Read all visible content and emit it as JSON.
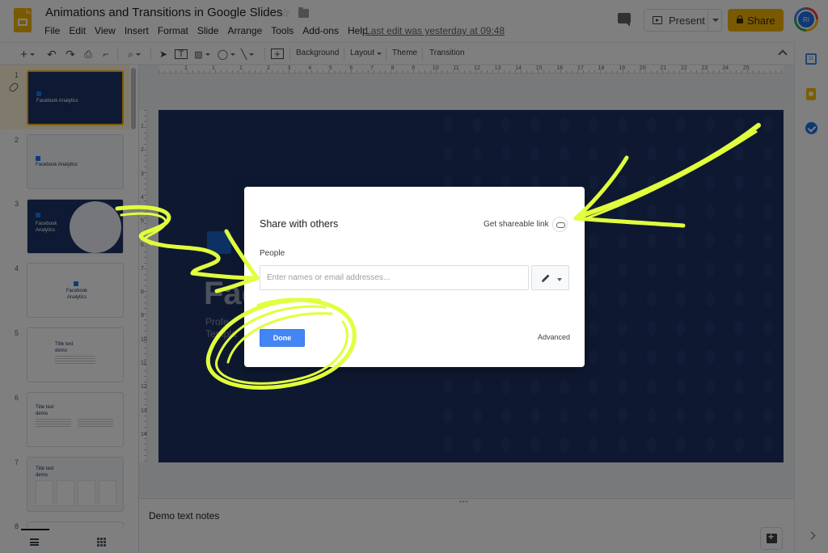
{
  "app": {
    "doc_title": "Animations and Transitions in Google Slides",
    "menu": [
      "File",
      "Edit",
      "View",
      "Insert",
      "Format",
      "Slide",
      "Arrange",
      "Tools",
      "Add-ons",
      "Help"
    ],
    "last_edit": "Last edit was yesterday at 09:48",
    "present_label": "Present",
    "share_label": "Share",
    "avatar_initials": "RI",
    "brand_color": "#f4b400"
  },
  "toolbar": {
    "background": "Background",
    "layout": "Layout",
    "theme": "Theme",
    "transition": "Transition"
  },
  "filmstrip": {
    "slides": [
      {
        "num": "1",
        "title": "Facebook Analytics"
      },
      {
        "num": "2",
        "title": "Facebook Analytics"
      },
      {
        "num": "3",
        "title": "Facebook Analytics"
      },
      {
        "num": "4",
        "title": "Facebook Analytics"
      },
      {
        "num": "5",
        "title": "Title text demo"
      },
      {
        "num": "6",
        "title": "Title text demo"
      },
      {
        "num": "7",
        "title": "Title text demo"
      },
      {
        "num": "8"
      }
    ]
  },
  "ruler": {
    "top": [
      "1",
      "1",
      "1",
      "2",
      "3",
      "4",
      "5",
      "6",
      "7",
      "8",
      "9",
      "10",
      "11",
      "12",
      "13",
      "14",
      "15",
      "16",
      "17",
      "18",
      "19",
      "20",
      "21",
      "22",
      "23",
      "24",
      "25"
    ],
    "left": [
      "1",
      "2",
      "3",
      "4",
      "5",
      "6",
      "7",
      "8",
      "9",
      "10",
      "11",
      "12",
      "13",
      "14"
    ]
  },
  "slide": {
    "title": "Fac",
    "subtitle_line1": "Profe",
    "subtitle_line2": "Templa"
  },
  "notes": {
    "text": "Demo text notes"
  },
  "dialog": {
    "title": "Share with others",
    "shareable_link": "Get shareable link",
    "people_label": "People",
    "people_placeholder": "Enter names or email addresses...",
    "done_label": "Done",
    "advanced_label": "Advanced",
    "accent_color": "#4285f4"
  },
  "annotation_color": "#e1ff3c"
}
